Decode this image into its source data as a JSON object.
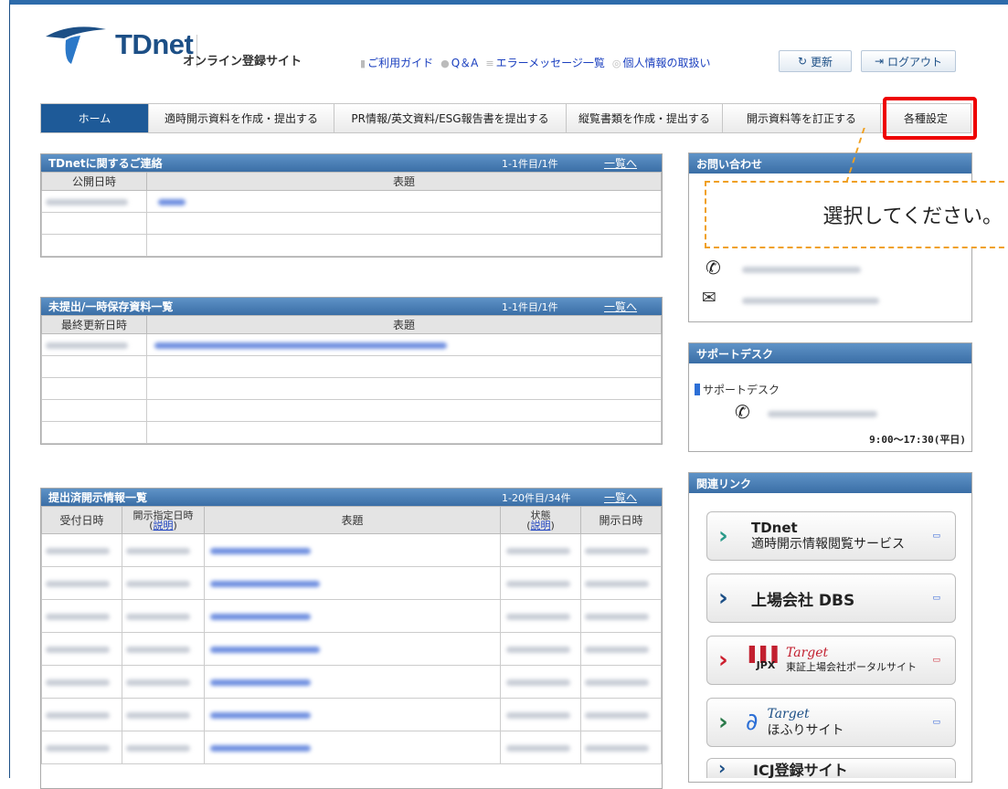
{
  "header": {
    "logo_text": "TDnet",
    "site_name": "オンライン登録サイト",
    "links": [
      {
        "icon": "guide-icon",
        "label": "ご利用ガイド"
      },
      {
        "icon": "qa-icon",
        "label": "Q＆A"
      },
      {
        "icon": "list-icon",
        "label": "エラーメッセージ一覧"
      },
      {
        "icon": "info-icon",
        "label": "個人情報の取扱い"
      }
    ],
    "refresh_label": "更新",
    "logout_label": "ログアウト"
  },
  "nav": {
    "items": [
      {
        "label": "ホーム",
        "active": true
      },
      {
        "label": "適時開示資料を作成・提出する"
      },
      {
        "label": "PR情報/英文資料/ESG報告書を提出する"
      },
      {
        "label": "縦覧書類を作成・提出する"
      },
      {
        "label": "開示資料等を訂正する"
      },
      {
        "label": "各種設定",
        "highlighted": true
      }
    ]
  },
  "callout_text": "選択してください。",
  "contacts_panel": {
    "title": "TDnetに関するご連絡",
    "count": "1-1件目/1件",
    "more": "一覧へ",
    "columns": [
      "公開日時",
      "表題"
    ]
  },
  "drafts_panel": {
    "title": "未提出/一時保存資料一覧",
    "count": "1-1件目/1件",
    "more": "一覧へ",
    "columns": [
      "最終更新日時",
      "表題"
    ]
  },
  "submitted_panel": {
    "title": "提出済開示情報一覧",
    "count": "1-20件目/34件",
    "more": "一覧へ",
    "columns": [
      "受付日時",
      "開示指定日時",
      "表題",
      "状態",
      "開示日時"
    ],
    "explain": "説明"
  },
  "sidebar": {
    "inquiry_title": "お問い合わせ",
    "support_title": "サポートデスク",
    "support_label": "サポートデスク",
    "support_hours": "9:00～17:30(平日)",
    "links_title": "関連リンク",
    "links": [
      {
        "line1": "TDnet",
        "line2": "適時開示情報閲覧サービス",
        "accent": "#2a9a8a"
      },
      {
        "line1": "上場会社 DBS",
        "line2": "",
        "accent": "#1c4f86"
      },
      {
        "line1": "Target",
        "line2": "東証上場会社ポータルサイト",
        "logo": "JPX",
        "accent": "#cc1f2f"
      },
      {
        "line1": "Target",
        "line2": "ほふりサイト",
        "accent": "#2a7a4a"
      },
      {
        "line1": "ICJ登録サイト",
        "line2": "",
        "accent": "#1c4f86"
      }
    ]
  }
}
